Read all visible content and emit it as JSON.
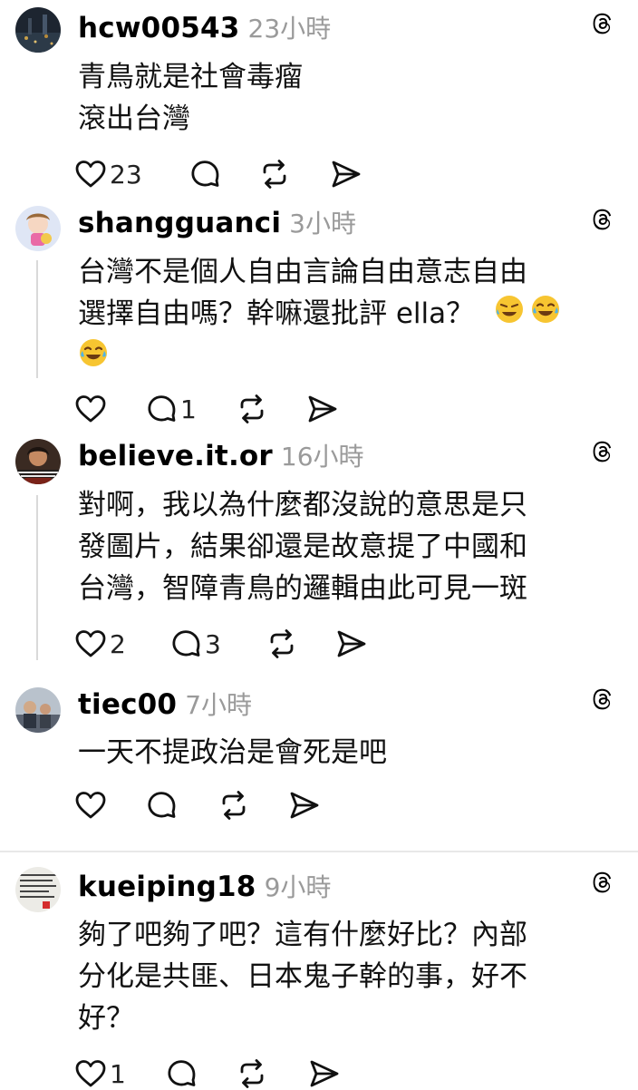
{
  "posts": [
    {
      "username": "hcw00543",
      "time": "23小時",
      "lines": [
        "青鳥就是社會毒瘤",
        "滾出台灣"
      ],
      "likes": "23",
      "replies": ""
    },
    {
      "username": "shangguanci",
      "time": "3小時",
      "lines": [
        "台灣不是個人自由言論自由意志自由",
        "選擇自由嗎？幹嘛還批評 ella？"
      ],
      "likes": "",
      "replies": "1"
    },
    {
      "username": "believe.it.or",
      "time": "16小時",
      "lines": [
        "對啊，我以為什麼都沒說的意思是只",
        "發圖片，結果卻還是故意提了中國和",
        "台灣，智障青鳥的邏輯由此可見一斑"
      ],
      "likes": "2",
      "replies": "3"
    },
    {
      "username": "tiec00",
      "time": "7小時",
      "lines": [
        "一天不提政治是會死是吧"
      ],
      "likes": "",
      "replies": ""
    },
    {
      "username": "kueiping18",
      "time": "9小時",
      "lines": [
        "夠了吧夠了吧？這有什麼好比？內部",
        "分化是共匪、日本鬼子幹的事，好不",
        "好？"
      ],
      "likes": "1",
      "replies": ""
    }
  ],
  "icons": {
    "like": "heart-icon",
    "reply": "comment-bubble-icon",
    "repost": "repost-icon",
    "share": "send-icon",
    "threads": "threads-logo-icon"
  }
}
